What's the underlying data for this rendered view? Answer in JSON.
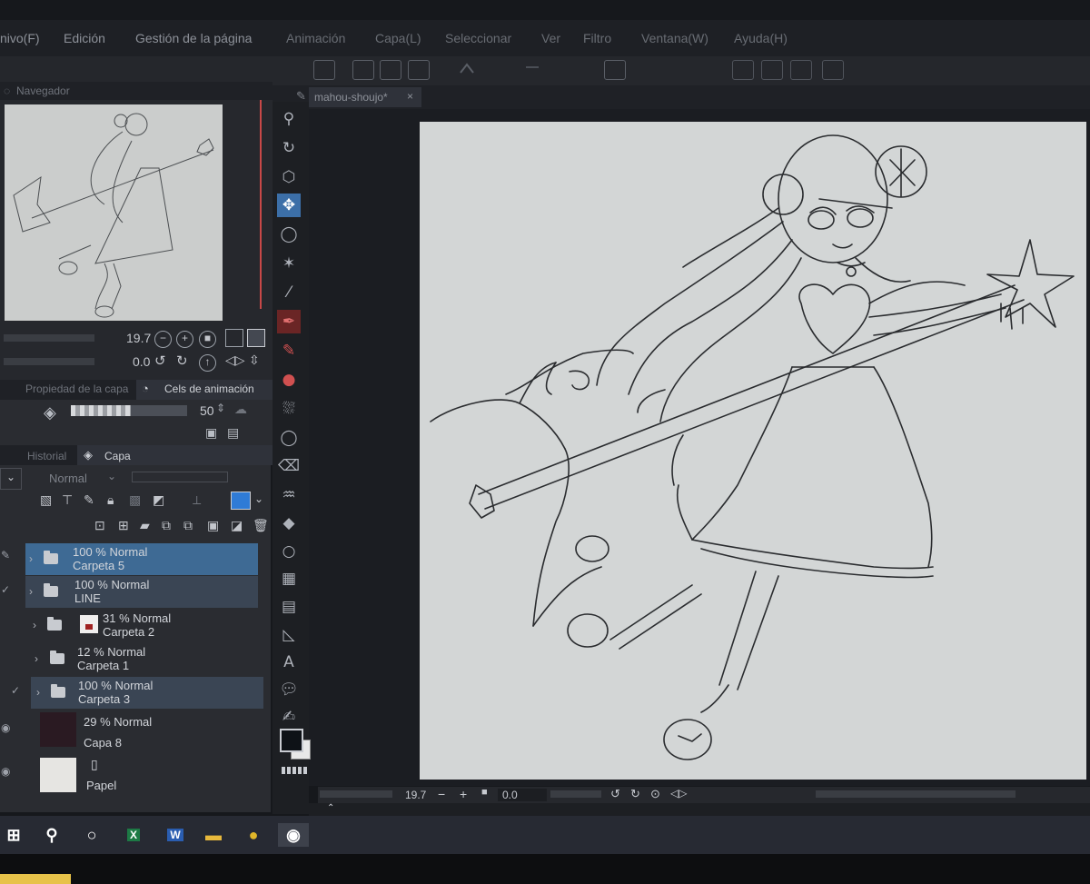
{
  "menu": [
    "nivo(F)",
    "Edición",
    "Gestión de la página",
    "Animación",
    "Capa(L)",
    "Seleccionar",
    "Ver",
    "Filtro",
    "Ventana(W)",
    "Ayuda(H)"
  ],
  "document_tab": {
    "title": "mahou-shoujo*",
    "close": "×"
  },
  "navigator": {
    "title": "Navegador",
    "zoom": "19.7",
    "rotation": "0.0"
  },
  "layer_property": {
    "tabs": [
      "Propiedad de la capa",
      "Cels de animación"
    ],
    "opacity": "50"
  },
  "layer_panel": {
    "tabs": [
      "Historial",
      "Capa"
    ],
    "blend_mode": "Normal",
    "layers": [
      {
        "name": "Carpeta 5",
        "mode": "100 % Normal",
        "type": "folder",
        "selected": true
      },
      {
        "name": "LINE",
        "mode": "100 % Normal",
        "type": "folder",
        "selected": true
      },
      {
        "name": "Carpeta 2",
        "mode": "31 % Normal",
        "type": "folder",
        "selected": false
      },
      {
        "name": "Carpeta 1",
        "mode": "12 % Normal",
        "type": "folder",
        "selected": false
      },
      {
        "name": "Carpeta 3",
        "mode": "100 % Normal",
        "type": "folder",
        "selected": true
      },
      {
        "name": "Capa 8",
        "mode": "29 % Normal",
        "type": "raster",
        "selected": false
      },
      {
        "name": "Papel",
        "mode": "",
        "type": "paper",
        "selected": false
      }
    ]
  },
  "tools": [
    "zoom-icon",
    "rotate-icon",
    "object-icon",
    "move-icon",
    "lasso-icon",
    "magic-wand-icon",
    "eyedropper-icon",
    "pen-icon",
    "pencil-icon",
    "brush-icon",
    "airbrush-icon",
    "decoration-icon",
    "eraser-icon",
    "blend-icon",
    "fill-icon",
    "shape-icon",
    "gradient-icon",
    "frame-icon",
    "ruler-icon",
    "text-icon",
    "balloon-icon",
    "line-correction-icon"
  ],
  "status_bar": {
    "zoom": "19.7",
    "rotation": "0.0"
  },
  "colors": {
    "main": "#0e1217",
    "sub": "#e8e8e8",
    "accent": "#2f7bd6",
    "paper": "#d3d6d6"
  },
  "taskbar": [
    "windows-icon",
    "search-icon",
    "cortana-icon",
    "excel-icon",
    "word-icon",
    "file-explorer-icon",
    "chrome-icon",
    "clip-studio-icon"
  ]
}
